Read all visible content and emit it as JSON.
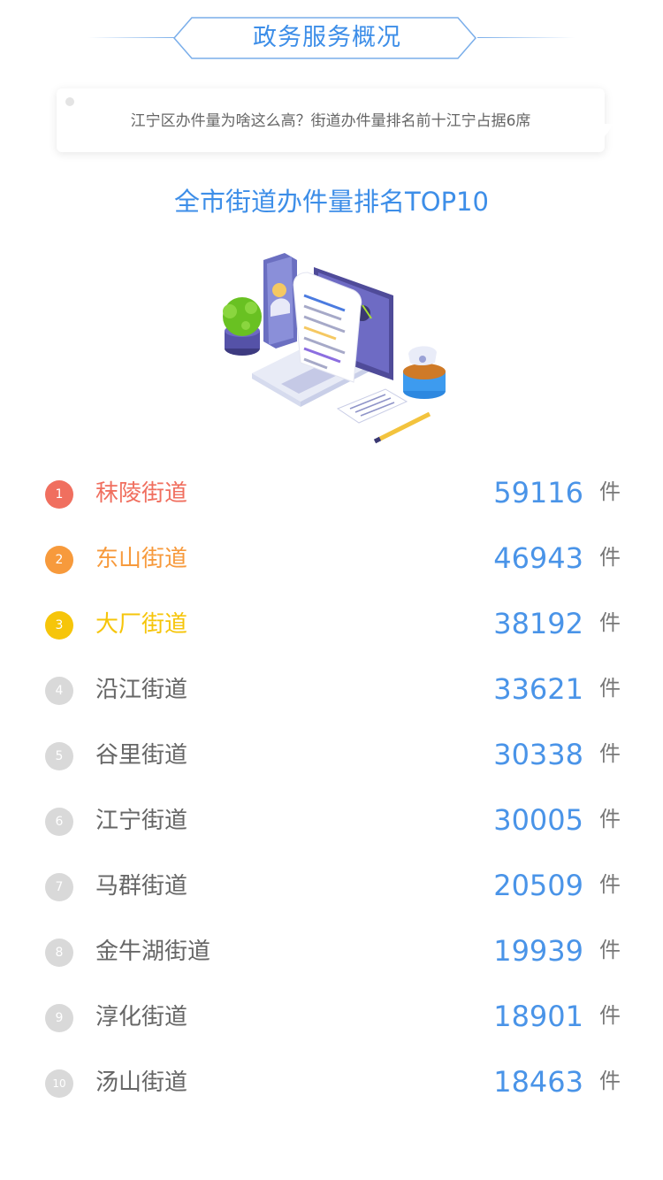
{
  "header": {
    "title": "政务服务概况"
  },
  "intro": {
    "text": "江宁区办件量为啥这么高？街道办件量排名前十江宁占据6席"
  },
  "section": {
    "title": "全市街道办件量排名TOP10"
  },
  "unit_label": "件",
  "colors": {
    "accent_blue": "#3d8ee8",
    "rank1": "#f06f5f",
    "rank2": "#f79a3c",
    "rank3": "#f6c50a",
    "rank_other_badge": "#d9d9d9",
    "rank_other_text": "#666666"
  },
  "illustration": {
    "icon": "document-laptop-illustration"
  },
  "ranking": [
    {
      "rank": "1",
      "name": "秣陵街道",
      "count": "59116"
    },
    {
      "rank": "2",
      "name": "东山街道",
      "count": "46943"
    },
    {
      "rank": "3",
      "name": "大厂街道",
      "count": "38192"
    },
    {
      "rank": "4",
      "name": "沿江街道",
      "count": "33621"
    },
    {
      "rank": "5",
      "name": "谷里街道",
      "count": "30338"
    },
    {
      "rank": "6",
      "name": "江宁街道",
      "count": "30005"
    },
    {
      "rank": "7",
      "name": "马群街道",
      "count": "20509"
    },
    {
      "rank": "8",
      "name": "金牛湖街道",
      "count": "19939"
    },
    {
      "rank": "9",
      "name": "淳化街道",
      "count": "18901"
    },
    {
      "rank": "10",
      "name": "汤山街道",
      "count": "18463"
    }
  ]
}
